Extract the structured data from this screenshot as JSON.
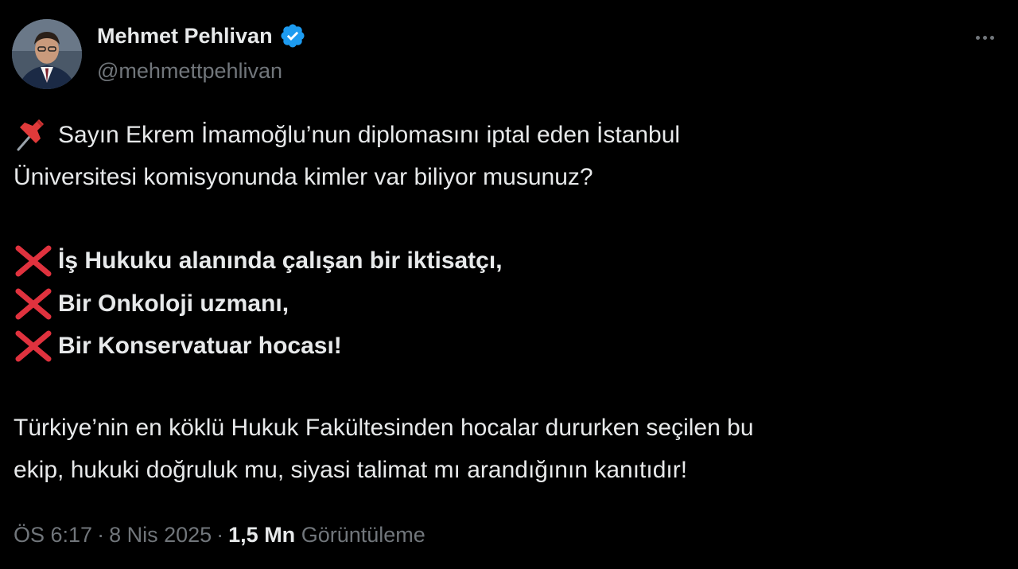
{
  "author": {
    "display_name": "Mehmet Pehlivan",
    "handle": "@mehmettpehlivan",
    "verified": true
  },
  "post": {
    "intro_line_1": "Sayın Ekrem İmamoğlu’nun diplomasını iptal eden İstanbul",
    "intro_line_2": "Üniversitesi komisyonunda kimler var biliyor musunuz?",
    "items": [
      "İş Hukuku alanında çalışan bir iktisatçı,",
      "Bir Onkoloji uzmanı,",
      "Bir Konservatuar hocası!"
    ],
    "closing_line_1": "Türkiye’nin en köklü Hukuk Fakültesinden hocalar dururken seçilen bu",
    "closing_line_2": "ekip, hukuki doğruluk mu, siyasi talimat mı arandığının kanıtıdır!"
  },
  "meta": {
    "time": "ÖS 6:17",
    "separator": "·",
    "date": "8 Nis 2025",
    "views_count": "1,5 Mn",
    "views_label": "Görüntüleme"
  },
  "colors": {
    "background": "#000000",
    "text_primary": "#e7e9ea",
    "text_secondary": "#71767b",
    "verified_badge": "#1d9bf0",
    "cross_mark": "#e0323e",
    "pushpin": "#e03a3a"
  },
  "icons": {
    "verified": "verified-badge-icon",
    "more": "more-options-icon",
    "pin": "pushpin-emoji",
    "cross": "cross-mark-emoji"
  }
}
